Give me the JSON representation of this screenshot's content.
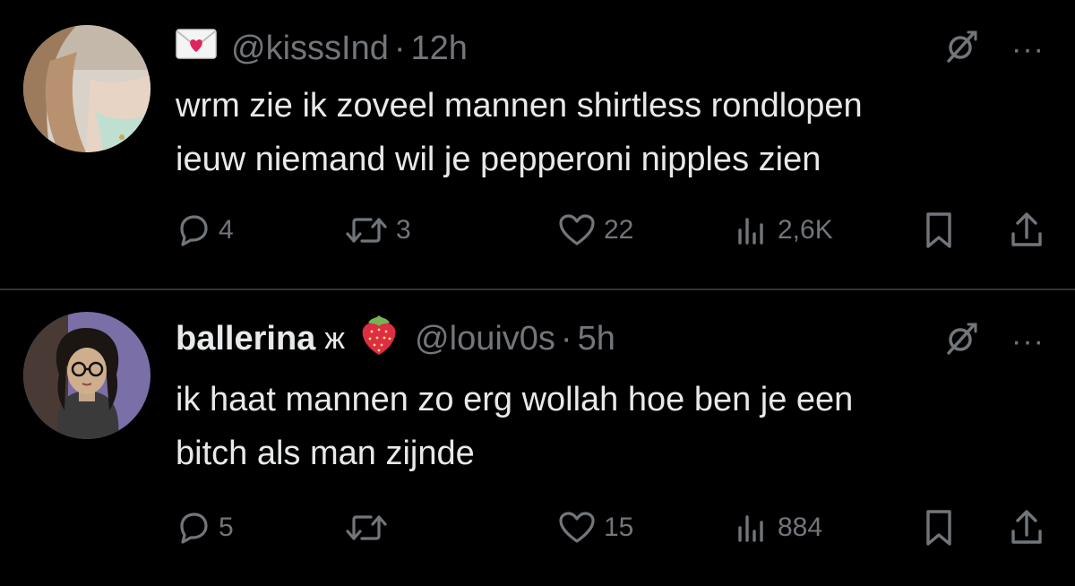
{
  "tweets": [
    {
      "display_name": "",
      "handle": "@kisssInd",
      "time": "12h",
      "lines": [
        "wrm zie ik zoveel mannen shirtless rondlopen",
        "ieuw niemand wil je pepperoni nipples zien"
      ],
      "stats": {
        "replies": "4",
        "retweets": "3",
        "likes": "22",
        "views": "2,6K"
      },
      "avatar_icon": "avatar-photo",
      "badge_icon": "love-letter-emoji"
    },
    {
      "display_name": "ballerina",
      "symbol": "ж",
      "handle": "@louiv0s",
      "time": "5h",
      "lines": [
        "ik haat mannen zo erg wollah hoe ben je een",
        "bitch als man zijnde"
      ],
      "stats": {
        "replies": "5",
        "retweets": "",
        "likes": "15",
        "views": "884"
      },
      "avatar_icon": "cartoon-girl-avatar",
      "badge_icon": "strawberry-emoji"
    }
  ],
  "separator": "·",
  "more_label": "···",
  "colors": {
    "background": "#000000",
    "text": "#e7e9ea",
    "muted": "#71767b",
    "divider": "#2f3336"
  }
}
